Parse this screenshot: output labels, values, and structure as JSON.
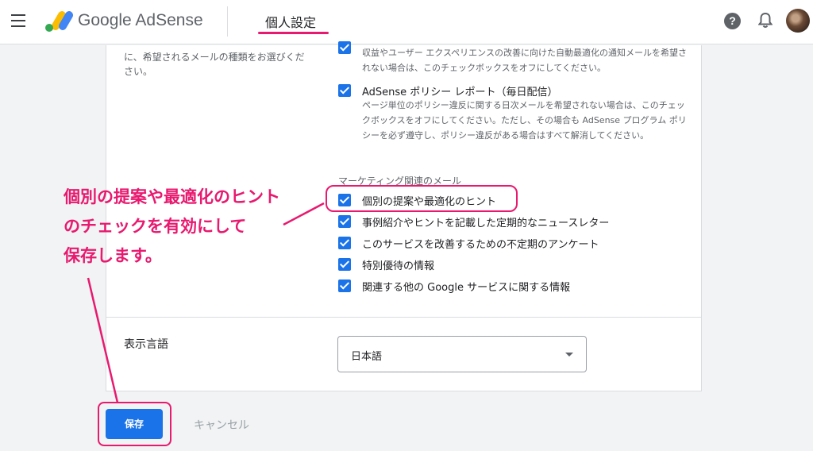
{
  "header": {
    "brand": "Google AdSense",
    "page_title": "個人設定"
  },
  "icons": {
    "menu": "hamburger-menu-icon",
    "logo": "adsense-logo-icon",
    "help": "help-icon",
    "notifications": "bell-icon",
    "account": "avatar"
  },
  "colors": {
    "accent": "#1a73e8",
    "annotation": "#e8196e"
  },
  "email_settings": {
    "left_description": "に、希望されるメールの種類をお選びください。",
    "items": [
      {
        "label": "",
        "description": "収益やユーザー エクスペリエンスの改善に向けた自動最適化の通知メールを希望されない場合は、このチェックボックスをオフにしてください。",
        "checked": true
      },
      {
        "label": "AdSense ポリシー レポート（毎日配信）",
        "description": "ページ単位のポリシー違反に関する日次メールを希望されない場合は、このチェックボックスをオフにしてください。ただし、その場合も AdSense プログラム ポリシーを必ず遵守し、ポリシー違反がある場合はすべて解消してください。",
        "checked": true
      }
    ],
    "marketing_label": "マーケティング関連のメール",
    "marketing_items": [
      {
        "label": "個別の提案や最適化のヒント",
        "checked": true
      },
      {
        "label": "事例紹介やヒントを記載した定期的なニュースレター",
        "checked": true
      },
      {
        "label": "このサービスを改善するための不定期のアンケート",
        "checked": true
      },
      {
        "label": "特別優待の情報",
        "checked": true
      },
      {
        "label": "関連する他の Google サービスに関する情報",
        "checked": true
      }
    ]
  },
  "language": {
    "label": "表示言語",
    "selected": "日本語"
  },
  "actions": {
    "save": "保存",
    "cancel": "キャンセル"
  },
  "annotation": {
    "line1": "個別の提案や最適化のヒント",
    "line2": "のチェックを有効にして",
    "line3": "保存します。"
  }
}
